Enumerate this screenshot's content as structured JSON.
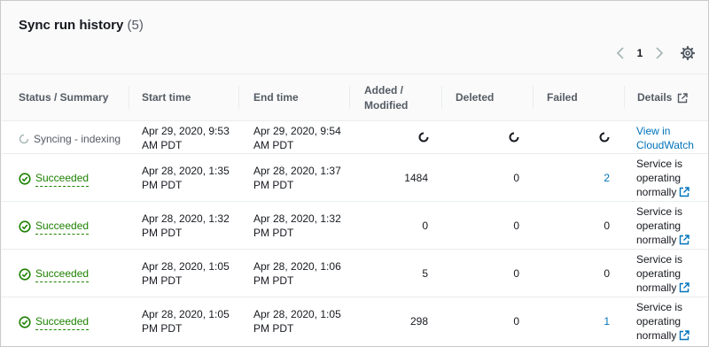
{
  "title": {
    "text": "Sync run history",
    "count": "(5)"
  },
  "pagination": {
    "current_page": "1"
  },
  "icons": {
    "prev": "chevron-left-icon",
    "next": "chevron-right-icon",
    "settings": "gear-icon",
    "external": "external-link-icon",
    "success": "check-circle-icon",
    "loading": "spinner-icon"
  },
  "colors": {
    "success": "#1d8102",
    "link": "#0073bb",
    "muted": "#545b64"
  },
  "columns": {
    "status": "Status / Summary",
    "start": "Start time",
    "end": "End time",
    "added_line1": "Added /",
    "added_line2": "Modified",
    "deleted": "Deleted",
    "failed": "Failed",
    "details": "Details"
  },
  "rows": [
    {
      "status": "Syncing - indexing",
      "start_l1": "Apr 29, 2020, 9:53",
      "start_l2": "AM PDT",
      "end_l1": "Apr 29, 2020, 9:54",
      "end_l2": "AM PDT",
      "added": "",
      "deleted": "",
      "failed": "",
      "details_l1": "View in",
      "details_l2": "CloudWatch",
      "details_l3": ""
    },
    {
      "status": "Succeeded",
      "start_l1": "Apr 28, 2020, 1:35",
      "start_l2": "PM PDT",
      "end_l1": "Apr 28, 2020, 1:37",
      "end_l2": "PM PDT",
      "added": "1484",
      "deleted": "0",
      "failed": "2",
      "details_l1": "Service is",
      "details_l2": "operating",
      "details_l3": "normally"
    },
    {
      "status": "Succeeded",
      "start_l1": "Apr 28, 2020, 1:32",
      "start_l2": "PM PDT",
      "end_l1": "Apr 28, 2020, 1:32",
      "end_l2": "PM PDT",
      "added": "0",
      "deleted": "0",
      "failed": "0",
      "details_l1": "Service is",
      "details_l2": "operating",
      "details_l3": "normally"
    },
    {
      "status": "Succeeded",
      "start_l1": "Apr 28, 2020, 1:05",
      "start_l2": "PM PDT",
      "end_l1": "Apr 28, 2020, 1:06",
      "end_l2": "PM PDT",
      "added": "5",
      "deleted": "0",
      "failed": "0",
      "details_l1": "Service is",
      "details_l2": "operating",
      "details_l3": "normally"
    },
    {
      "status": "Succeeded",
      "start_l1": "Apr 28, 2020, 1:05",
      "start_l2": "PM PDT",
      "end_l1": "Apr 28, 2020, 1:05",
      "end_l2": "PM PDT",
      "added": "298",
      "deleted": "0",
      "failed": "1",
      "details_l1": "Service is",
      "details_l2": "operating",
      "details_l3": "normally"
    }
  ]
}
